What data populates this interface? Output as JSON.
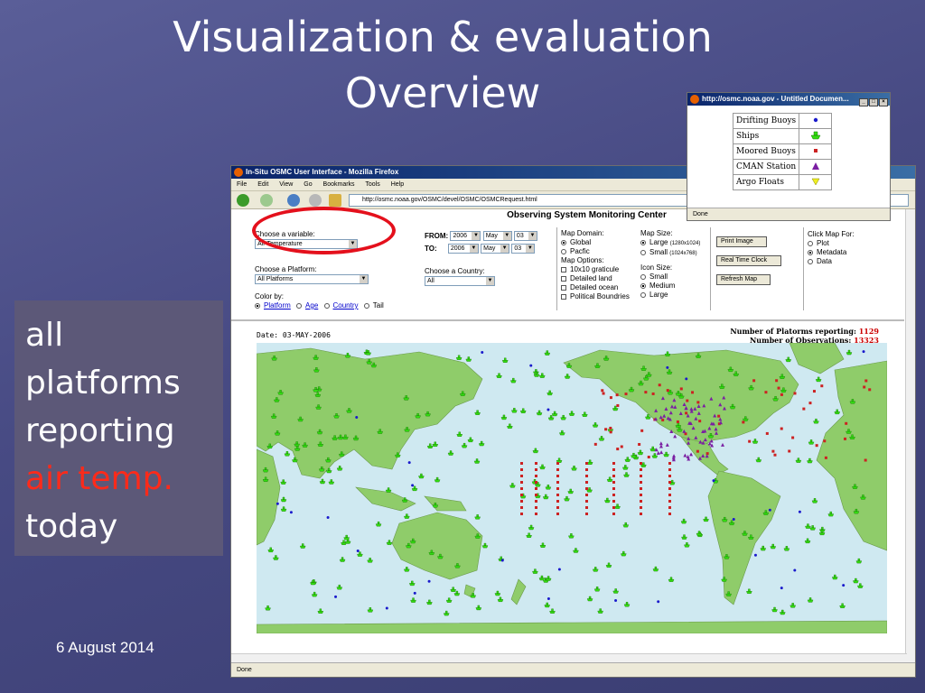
{
  "slide": {
    "title_line1": "Visualization & evaluation",
    "title_line2": "Overview",
    "side_lines": [
      "all",
      "platforms",
      "reporting"
    ],
    "side_highlight": "air temp.",
    "side_last": "today",
    "date": "6 August 2014"
  },
  "browser": {
    "title": "In-Situ OSMC User Interface - Mozilla Firefox",
    "menu": [
      "File",
      "Edit",
      "View",
      "Go",
      "Bookmarks",
      "Tools",
      "Help"
    ],
    "url": "http://osmc.noaa.gov/OSMC/devel/OSMC/OSMCRequest.html",
    "status": "Done"
  },
  "page": {
    "header": "Observing System Monitoring Center",
    "variable_label": "Choose a variable:",
    "variable_value": "Air Temperature",
    "platform_label": "Choose a Platform:",
    "platform_value": "All Platforms",
    "colorby_label": "Color by:",
    "colorby_options": [
      "Platform",
      "Age",
      "Country",
      "Tail"
    ],
    "from_label": "FROM:",
    "to_label": "TO:",
    "from": {
      "year": "2006",
      "month": "May",
      "day": "03"
    },
    "to": {
      "year": "2006",
      "month": "May",
      "day": "03"
    },
    "country_label": "Choose a Country:",
    "country_value": "All",
    "domain_label": "Map Domain:",
    "domain_options": [
      "Global",
      "Pacfic"
    ],
    "options_label": "Map Options:",
    "map_options": [
      "10x10 graticule",
      "Detailed land",
      "Detailed ocean",
      "Political Boundries"
    ],
    "size_label": "Map Size:",
    "size_options": [
      {
        "label": "Large",
        "detail": "(1280x1024)"
      },
      {
        "label": "Small",
        "detail": "(1024x768)"
      }
    ],
    "icon_label": "Icon Size:",
    "icon_options": [
      "Small",
      "Medium",
      "Large"
    ],
    "buttons": [
      "Print Image",
      "Real Time Clock",
      "Refresh Map"
    ],
    "click_label": "Click Map For:",
    "click_options": [
      "Plot",
      "Metadata",
      "Data"
    ],
    "report_date": "Date: 03-MAY-2006",
    "reporting_label": "Number of Platorms reporting:",
    "reporting_value": "1129",
    "obs_label": "Number of Observations:",
    "obs_value": "13323"
  },
  "legend": {
    "title": "http://osmc.noaa.gov - Untitled Documen...",
    "items": [
      {
        "label": "Drifting Buoys",
        "icon": "blue-dot-icon",
        "color": "#1a1acc"
      },
      {
        "label": "Ships",
        "icon": "green-ship-icon",
        "color": "#33dd11"
      },
      {
        "label": "Moored Buoys",
        "icon": "red-square-icon",
        "color": "#cc2222"
      },
      {
        "label": "CMAN Station",
        "icon": "purple-triangle-icon",
        "color": "#7a1fa2"
      },
      {
        "label": "Argo Floats",
        "icon": "yellow-triangle-icon",
        "color": "#eeee22"
      }
    ],
    "status": "Done"
  },
  "colors": {
    "ocean": "#cfe9f1",
    "land": "#8fcc6a",
    "highlight": "#e4101c"
  }
}
